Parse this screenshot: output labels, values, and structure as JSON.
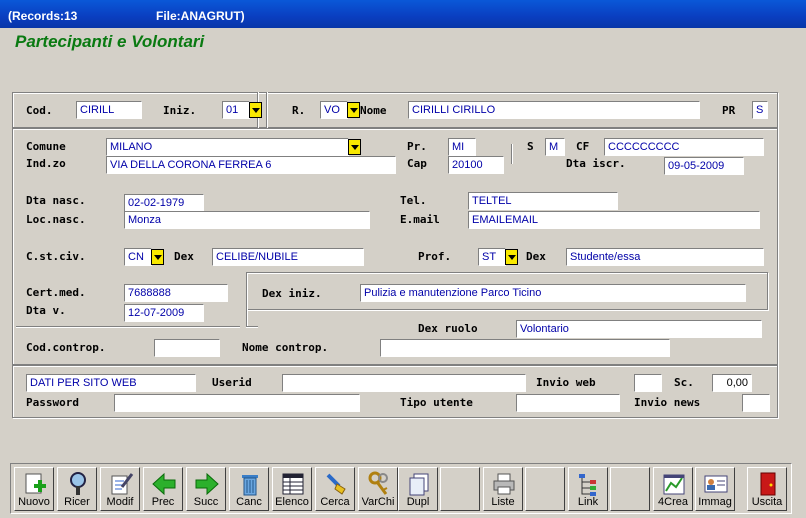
{
  "window": {
    "records": "(Records:13",
    "file": "File:ANAGRUT)"
  },
  "app_title": "Partecipanti e Volontari",
  "labels": {
    "cod": "Cod.",
    "iniz": "Iniz.",
    "r": "R.",
    "nome": "Nome",
    "pr_top": "PR",
    "comune": "Comune",
    "indzo": "Ind.zo",
    "pr": "Pr.",
    "cap": "Cap",
    "s": "S",
    "cf": "CF",
    "dta_iscr": "Dta iscr.",
    "dta_nasc": "Dta nasc.",
    "loc_nasc": "Loc.nasc.",
    "tel": "Tel.",
    "email": "E.mail",
    "cstciv": "C.st.civ.",
    "dex1": "Dex",
    "prof": "Prof.",
    "dex2": "Dex",
    "cert_med": "Cert.med.",
    "dta_v": "Dta v.",
    "dex_iniz": "Dex iniz.",
    "dex_ruolo": "Dex ruolo",
    "cod_controp": "Cod.controp.",
    "nome_controp": "Nome controp.",
    "userid": "Userid",
    "invio_web": "Invio web",
    "sc": "Sc.",
    "password": "Password",
    "tipo_utente": "Tipo utente",
    "invio_news": "Invio news"
  },
  "values": {
    "cod": "CIRILL",
    "iniz": "01",
    "r": "VO",
    "nome": "CIRILLI CIRILLO",
    "pr_top": "S",
    "comune": "MILANO",
    "indzo": "VIA DELLA CORONA FERREA 6",
    "pr": "MI",
    "cap": "20100",
    "s": "M",
    "cf": "CCCCCCCCC",
    "dta_iscr": "09-05-2009",
    "dta_nasc": "02-02-1979",
    "loc_nasc": "Monza",
    "tel": "TELTEL",
    "email": "EMAILEMAIL",
    "cstciv": "CN",
    "dex1": "CELIBE/NUBILE",
    "prof": "ST",
    "dex2": "Studente/essa",
    "cert_med": "7688888",
    "dta_v": "12-07-2009",
    "dex_iniz": "Pulizia e manutenzione Parco Ticino",
    "dex_ruolo": "Volontario",
    "cod_controp": "",
    "nome_controp": "",
    "dati_web": "DATI PER SITO WEB",
    "userid": "",
    "invio_web": "",
    "sc": "0,00",
    "password": "",
    "tipo_utente": "",
    "invio_news": ""
  },
  "toolbar": {
    "nuovo": "Nuovo",
    "ricer": "Ricer",
    "modif": "Modif",
    "prec": "Prec",
    "succ": "Succ",
    "canc": "Canc",
    "elenco": "Elenco",
    "cerca": "Cerca",
    "varchi": "VarChi",
    "dupl": "Dupl",
    "liste": "Liste",
    "link": "Link",
    "crea4": "4Crea",
    "immag": "Immag",
    "uscita": "Uscita"
  },
  "icons": [
    "add-icon",
    "search-icon",
    "edit-icon",
    "arrow-left-icon",
    "arrow-right-icon",
    "trash-icon",
    "list-icon",
    "brush-icon",
    "keys-icon",
    "copy-icon",
    "printer-icon",
    "tree-icon",
    "chart-icon",
    "id-card-icon",
    "exit-door-icon"
  ],
  "colors": {
    "title_green": "#0a7a12",
    "value_blue": "#0000a8",
    "dropdown_yellow": "#f8e800",
    "titlebar_blue": "#0a3ec0"
  }
}
